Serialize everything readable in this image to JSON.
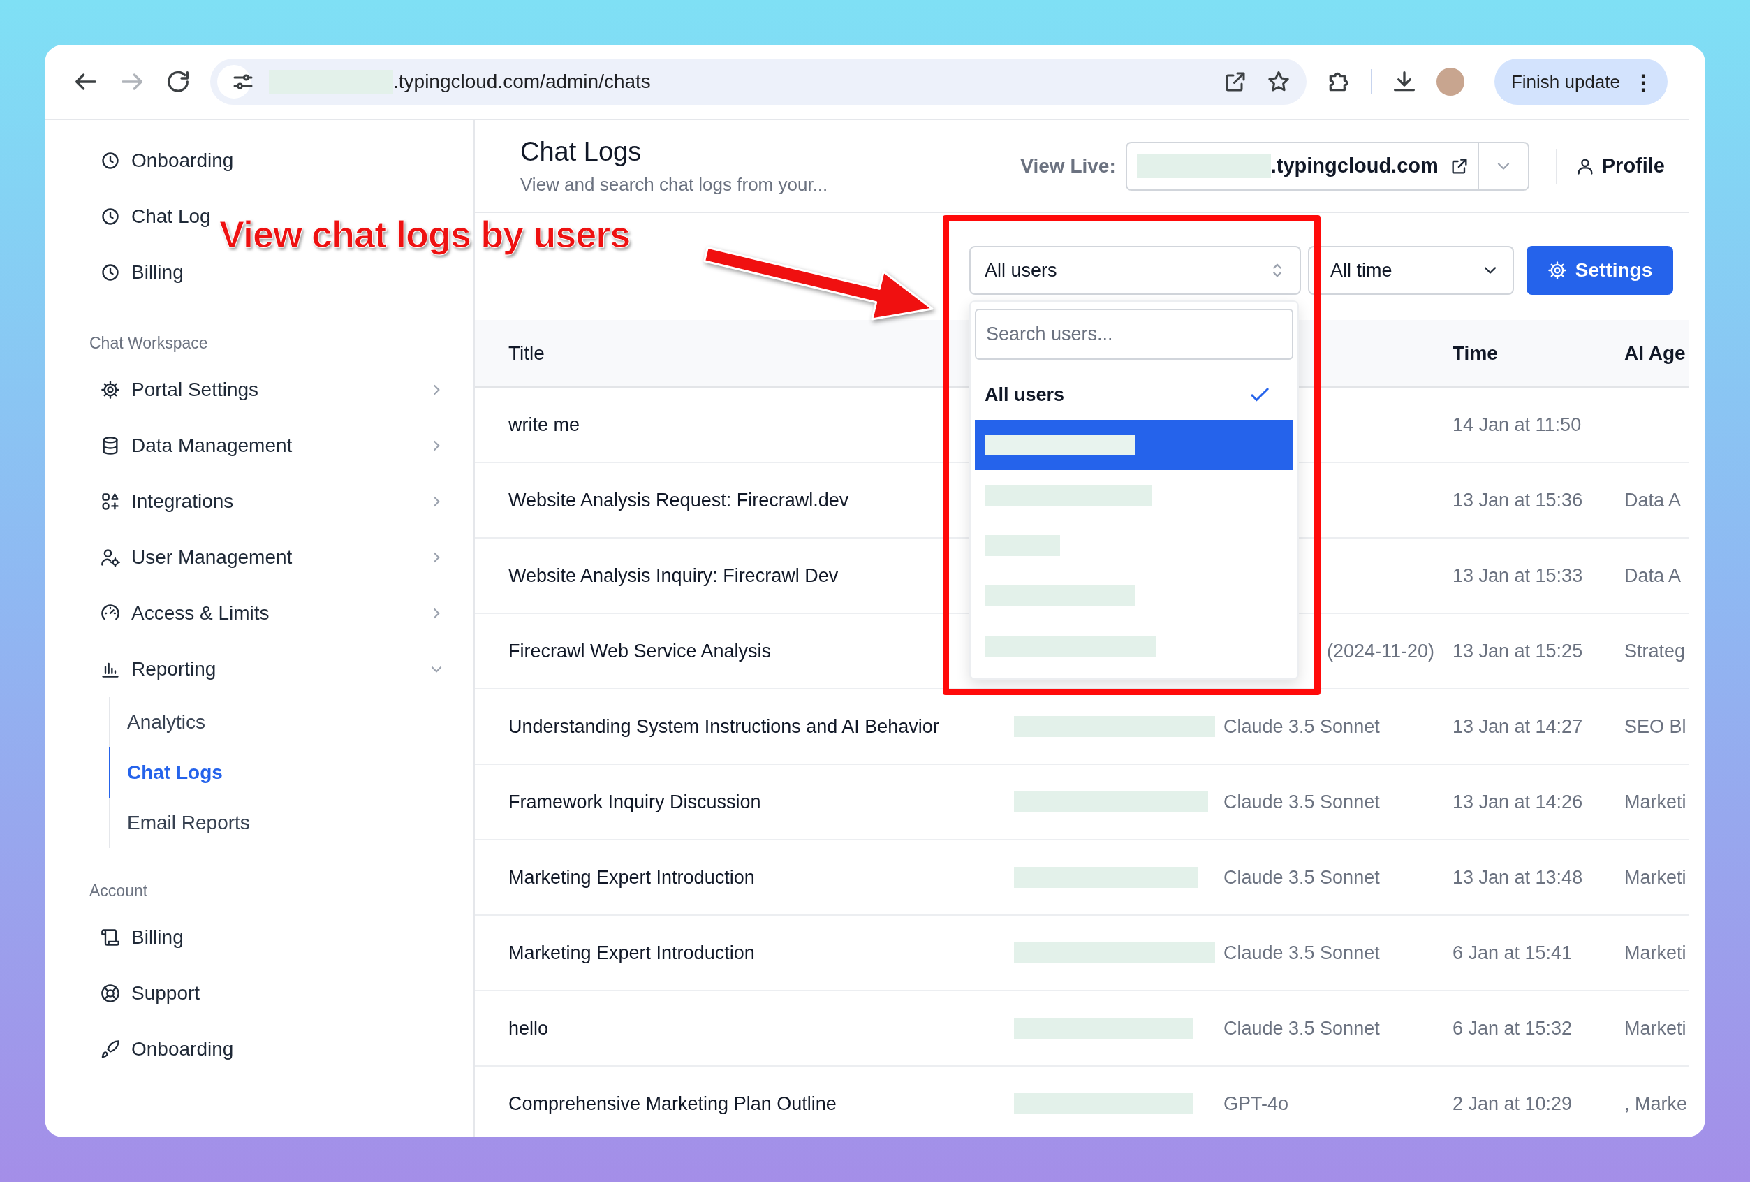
{
  "browser": {
    "url": ".typingcloud.com/admin/chats",
    "update_button": "Finish update",
    "menu_glyph": "⋮",
    "forward_disabled": true
  },
  "sidebar": {
    "recent": [
      {
        "label": "Onboarding"
      },
      {
        "label": "Chat Log"
      },
      {
        "label": "Billing"
      }
    ],
    "sections": [
      {
        "heading": "Chat Workspace",
        "items": [
          {
            "label": "Portal Settings",
            "expanded": false
          },
          {
            "label": "Data Management",
            "expanded": false
          },
          {
            "label": "Integrations",
            "expanded": false
          },
          {
            "label": "User Management",
            "expanded": false
          },
          {
            "label": "Access & Limits",
            "expanded": false
          },
          {
            "label": "Reporting",
            "expanded": true,
            "children": [
              {
                "label": "Analytics",
                "selected": false
              },
              {
                "label": "Chat Logs",
                "selected": true
              },
              {
                "label": "Email Reports",
                "selected": false
              }
            ]
          }
        ]
      },
      {
        "heading": "Account",
        "items": [
          {
            "label": "Billing"
          },
          {
            "label": "Support"
          },
          {
            "label": "Onboarding"
          }
        ]
      }
    ]
  },
  "page": {
    "title": "Chat Logs",
    "subtitle": "View and search chat logs from your...",
    "view_live_label": "View Live:",
    "live_domain": ".typingcloud.com",
    "profile": "Profile"
  },
  "filters": {
    "user_select": "All users",
    "time_select": "All time",
    "settings_button": "Settings"
  },
  "user_dropdown": {
    "search_placeholder": "Search users...",
    "options": [
      {
        "kind": "text",
        "label": "All users",
        "checked": true,
        "highlighted": false
      },
      {
        "kind": "redacted",
        "checked": false,
        "highlighted": true
      },
      {
        "kind": "redacted",
        "checked": false,
        "highlighted": false
      },
      {
        "kind": "redacted",
        "checked": false,
        "highlighted": false
      },
      {
        "kind": "redacted",
        "checked": false,
        "highlighted": false
      },
      {
        "kind": "redacted",
        "checked": false,
        "highlighted": false
      }
    ]
  },
  "table": {
    "columns": {
      "title": "Title",
      "time": "Time",
      "agent": "AI Age"
    },
    "rows": [
      {
        "title": "write me",
        "time": "14 Jan at 11:50"
      },
      {
        "title": "Website Analysis Request: Firecrawl.dev",
        "time": "13 Jan at 15:36",
        "agent": "Data A"
      },
      {
        "title": "Website Analysis Inquiry: Firecrawl Dev",
        "time": "13 Jan at 15:33",
        "agent": "Data A"
      },
      {
        "title": "Firecrawl Web Service Analysis",
        "model": "(2024-11-20)",
        "model_cut": true,
        "time": "13 Jan at 15:25",
        "agent": "Strateg"
      },
      {
        "title": "Understanding System Instructions and AI Behavior",
        "user_redacted": true,
        "model": "Claude 3.5 Sonnet",
        "model_cut": false,
        "time": "13 Jan at 14:27",
        "agent": "SEO Bl"
      },
      {
        "title": "Framework Inquiry Discussion",
        "user_redacted": true,
        "model": "Claude 3.5 Sonnet",
        "model_cut": false,
        "time": "13 Jan at 14:26",
        "agent": "Marketi"
      },
      {
        "title": "Marketing Expert Introduction",
        "user_redacted": true,
        "model": "Claude 3.5 Sonnet",
        "model_cut": false,
        "time": "13 Jan at 13:48",
        "agent": "Marketi"
      },
      {
        "title": "Marketing Expert Introduction",
        "user_redacted": true,
        "model": "Claude 3.5 Sonnet",
        "model_cut": false,
        "time": "6 Jan at 15:41",
        "agent": "Marketi"
      },
      {
        "title": "hello",
        "user_redacted": true,
        "model": "Claude 3.5 Sonnet",
        "model_cut": false,
        "time": "6 Jan at 15:32",
        "agent": "Marketi"
      },
      {
        "title": "Comprehensive Marketing Plan Outline",
        "user_redacted": true,
        "model": "GPT-4o",
        "model_cut": false,
        "time": "2 Jan at 10:29",
        "agent": ", Marke"
      }
    ]
  },
  "annotation": {
    "callout": "View chat logs by users"
  }
}
